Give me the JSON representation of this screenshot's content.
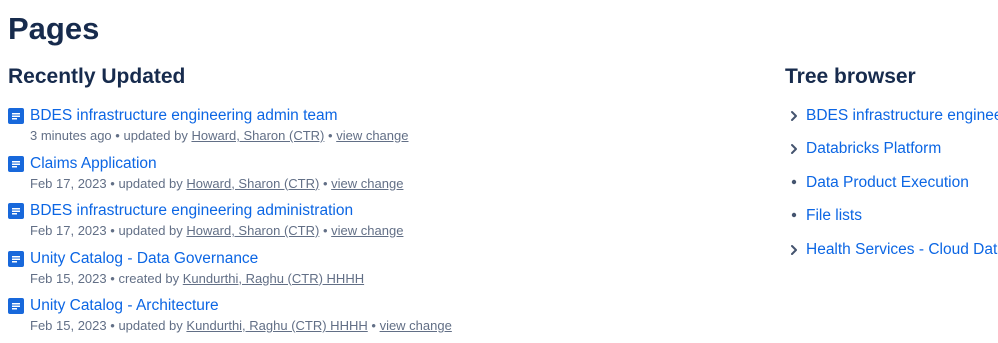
{
  "page": {
    "title": "Pages"
  },
  "recent": {
    "heading": "Recently Updated",
    "bullet": "•",
    "items": [
      {
        "title": "BDES infrastructure engineering admin team",
        "time": "3 minutes ago",
        "action": "updated by",
        "user": "Howard, Sharon (CTR)",
        "change": "view change"
      },
      {
        "title": "Claims Application",
        "time": "Feb 17, 2023",
        "action": "updated by",
        "user": "Howard, Sharon (CTR)",
        "change": "view change"
      },
      {
        "title": "BDES infrastructure engineering administration",
        "time": "Feb 17, 2023",
        "action": "updated by",
        "user": "Howard, Sharon (CTR)",
        "change": "view change"
      },
      {
        "title": "Unity Catalog - Data Governance",
        "time": "Feb 15, 2023",
        "action": "created by",
        "user": "Kundurthi, Raghu (CTR) HHHH",
        "change": ""
      },
      {
        "title": "Unity Catalog - Architecture",
        "time": "Feb 15, 2023",
        "action": "updated by",
        "user": "Kundurthi, Raghu (CTR) HHHH",
        "change": "view change"
      }
    ]
  },
  "tree": {
    "heading": "Tree browser",
    "items": [
      {
        "label": "BDES infrastructure engineering admin team",
        "marker": "chevron"
      },
      {
        "label": "Databricks Platform",
        "marker": "chevron"
      },
      {
        "label": "Data Product Execution",
        "marker": "bullet"
      },
      {
        "label": "File lists",
        "marker": "bullet"
      },
      {
        "label": "Health Services - Cloud Data",
        "marker": "chevron"
      }
    ]
  },
  "colors": {
    "heading": "#172b4d",
    "link": "#0c66e4",
    "meta": "#626f86",
    "icon": "#1868db"
  }
}
